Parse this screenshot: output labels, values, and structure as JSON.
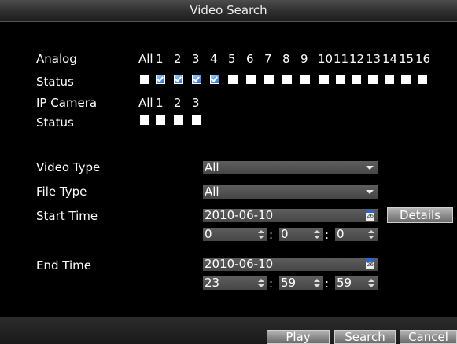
{
  "window": {
    "title": "Video Search"
  },
  "analog": {
    "label": "Analog",
    "status_label": "Status",
    "all_label": "All",
    "channels": [
      {
        "label": "1",
        "checked": true
      },
      {
        "label": "2",
        "checked": true
      },
      {
        "label": "3",
        "checked": true
      },
      {
        "label": "4",
        "checked": true
      },
      {
        "label": "5",
        "checked": false
      },
      {
        "label": "6",
        "checked": false
      },
      {
        "label": "7",
        "checked": false
      },
      {
        "label": "8",
        "checked": false
      },
      {
        "label": "9",
        "checked": false
      },
      {
        "label": "10",
        "checked": false
      },
      {
        "label": "11",
        "checked": false
      },
      {
        "label": "12",
        "checked": false
      },
      {
        "label": "13",
        "checked": false
      },
      {
        "label": "14",
        "checked": false
      },
      {
        "label": "15",
        "checked": false
      },
      {
        "label": "16",
        "checked": false
      }
    ],
    "all_checked": false
  },
  "ip_camera": {
    "label": "IP Camera",
    "status_label": "Status",
    "all_label": "All",
    "channels": [
      {
        "label": "1",
        "checked": false
      },
      {
        "label": "2",
        "checked": false
      },
      {
        "label": "3",
        "checked": false
      }
    ],
    "all_checked": false
  },
  "form": {
    "video_type": {
      "label": "Video Type",
      "value": "All"
    },
    "file_type": {
      "label": "File Type",
      "value": "All"
    },
    "start_time": {
      "label": "Start Time",
      "date": "2010-06-10",
      "hour": "0",
      "minute": "0",
      "second": "0",
      "calendar_day": "26"
    },
    "end_time": {
      "label": "End Time",
      "date": "2010-06-10",
      "hour": "23",
      "minute": "59",
      "second": "59",
      "calendar_day": "26"
    },
    "colon": ":"
  },
  "buttons": {
    "details": "Details",
    "play": "Play",
    "search": "Search",
    "cancel": "Cancel"
  },
  "colors": {
    "background": "#000000",
    "field": "#555555",
    "checkbox_checked": "#2f6fd0"
  }
}
